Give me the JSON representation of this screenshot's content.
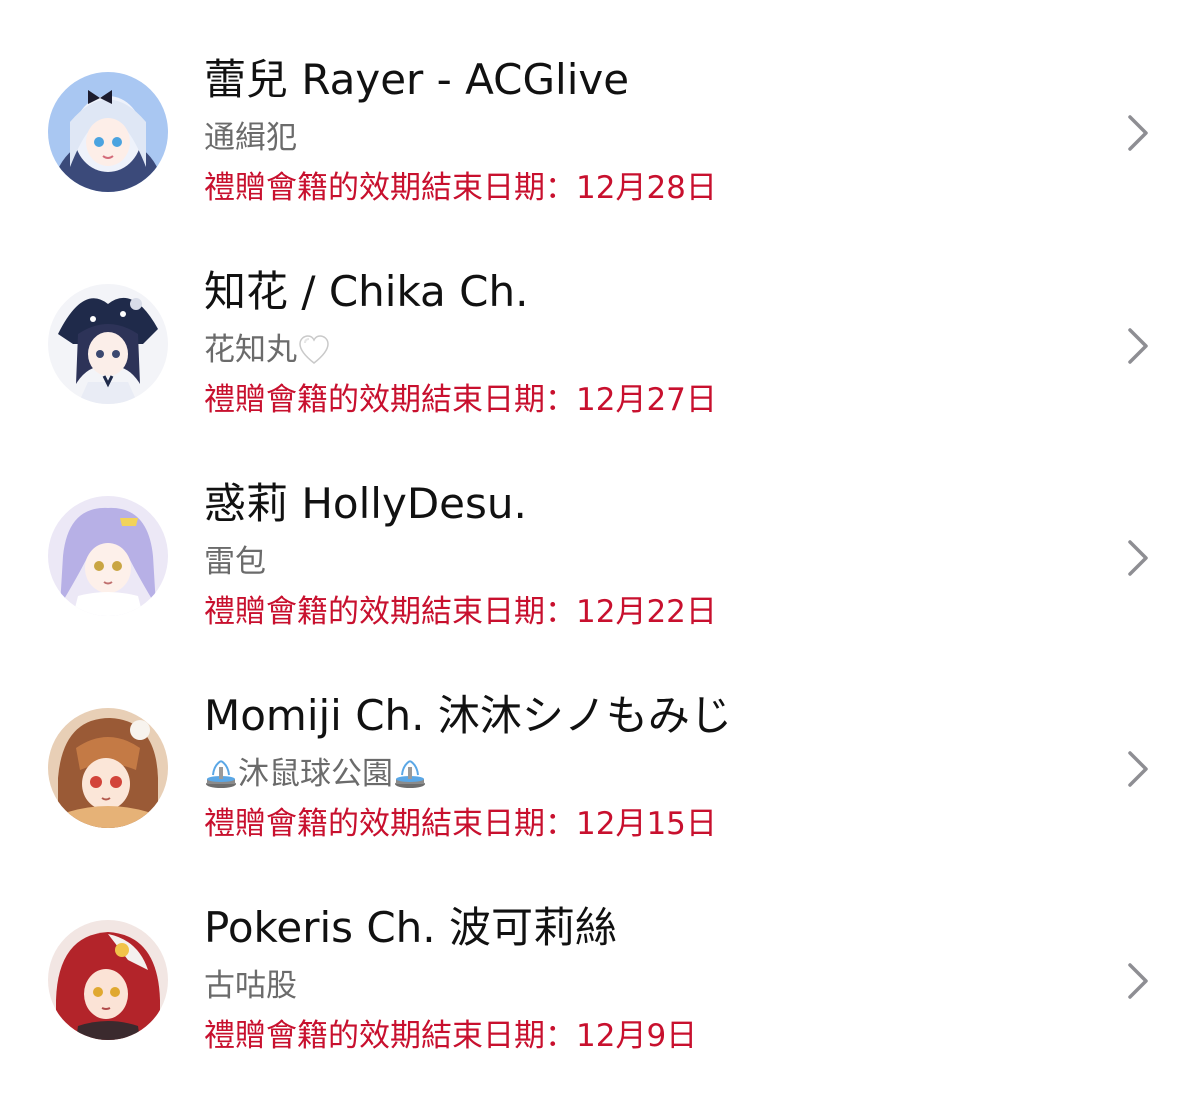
{
  "accent_color": "#c8102e",
  "items": [
    {
      "name": "蕾兒 Rayer - ACGlive",
      "subtitle": "通緝犯",
      "expiry": "禮贈會籍的效期結束日期：12月28日",
      "avatar_icon": "avatar-rayer"
    },
    {
      "name": "知花 / Chika Ch.",
      "subtitle": "花知丸",
      "subtitle_icon": "white-heart-icon",
      "expiry": "禮贈會籍的效期結束日期：12月27日",
      "avatar_icon": "avatar-chika"
    },
    {
      "name": "惑莉 HollyDesu.",
      "subtitle": "雷包",
      "expiry": "禮贈會籍的效期結束日期：12月22日",
      "avatar_icon": "avatar-holly"
    },
    {
      "name": "Momiji Ch. 沐沐シノもみじ",
      "subtitle": "沐鼠球公園",
      "subtitle_icon": "fountain-icon",
      "expiry": "禮贈會籍的效期結束日期：12月15日",
      "avatar_icon": "avatar-momiji"
    },
    {
      "name": "Pokeris Ch. 波可莉絲",
      "subtitle": "古咕股",
      "expiry": "禮贈會籍的效期結束日期：12月9日",
      "avatar_icon": "avatar-pokeris"
    }
  ]
}
